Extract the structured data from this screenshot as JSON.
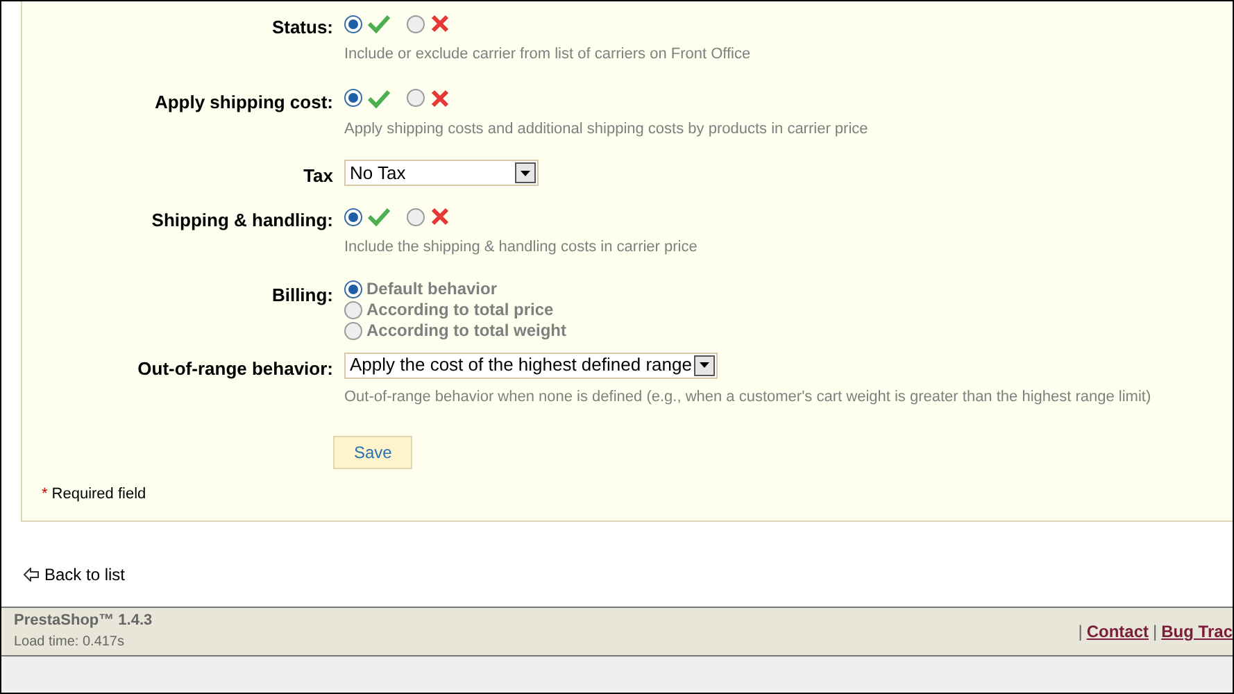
{
  "form": {
    "fields": [
      {
        "kind": "toggle",
        "label": "Status:",
        "enabled": true,
        "description": "Include or exclude carrier from list of carriers on Front Office"
      },
      {
        "kind": "toggle",
        "label": "Apply shipping cost:",
        "enabled": true,
        "description": "Apply shipping costs and additional shipping costs by products in carrier price"
      },
      {
        "kind": "select",
        "label": "Tax",
        "value": "No Tax"
      },
      {
        "kind": "toggle",
        "label": "Shipping & handling:",
        "enabled": true,
        "description": "Include the shipping & handling costs in carrier price"
      },
      {
        "kind": "radios",
        "label": "Billing:",
        "options": [
          {
            "label": "Default behavior",
            "selected": true
          },
          {
            "label": "According to total price",
            "selected": false
          },
          {
            "label": "According to total weight",
            "selected": false
          }
        ]
      },
      {
        "kind": "select",
        "label": "Out-of-range behavior:",
        "value": "Apply the cost of the highest defined range",
        "description": "Out-of-range behavior when none is defined (e.g., when a customer's cart weight is greater than the highest range limit)"
      }
    ],
    "save_button": "Save",
    "required_mark": "*",
    "required_note": "Required field"
  },
  "back_link": "Back to list",
  "footer": {
    "product": "PrestaShop™ 1.4.3",
    "load_time": "Load time: 0.417s",
    "separators": [
      "|",
      "|"
    ],
    "links": [
      "Contact",
      "Bug Trac"
    ]
  }
}
